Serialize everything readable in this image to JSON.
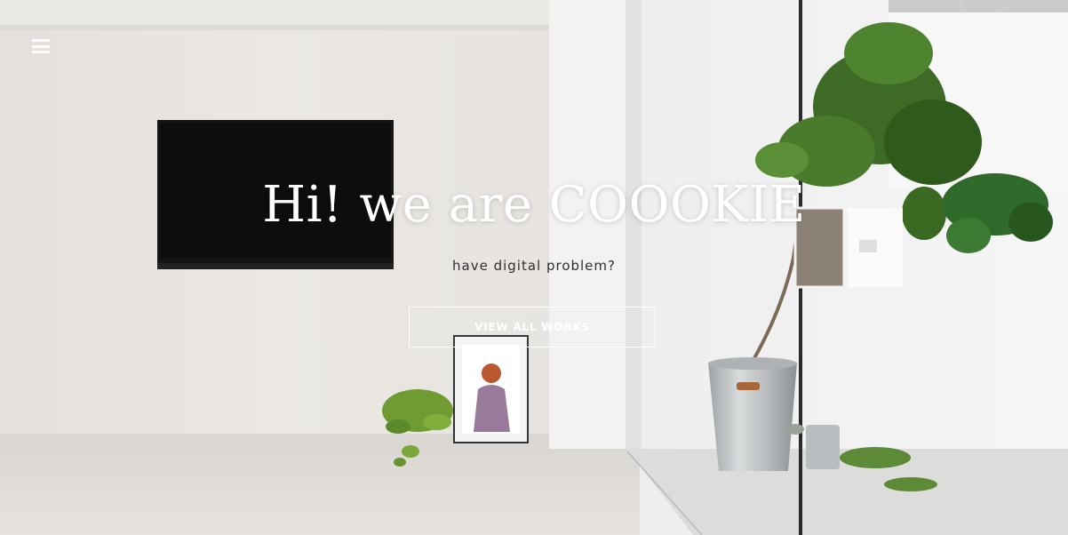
{
  "nav": {
    "menu_icon": "hamburger-menu-icon"
  },
  "hero": {
    "headline": "Hi! we are COOOKIE",
    "subheadline": "have digital problem?",
    "cta_label": "VIEW ALL WORKS"
  },
  "colors": {
    "text_light": "#ffffff",
    "text_dark": "#2f2f2f",
    "wall": "#e9e6e2"
  }
}
